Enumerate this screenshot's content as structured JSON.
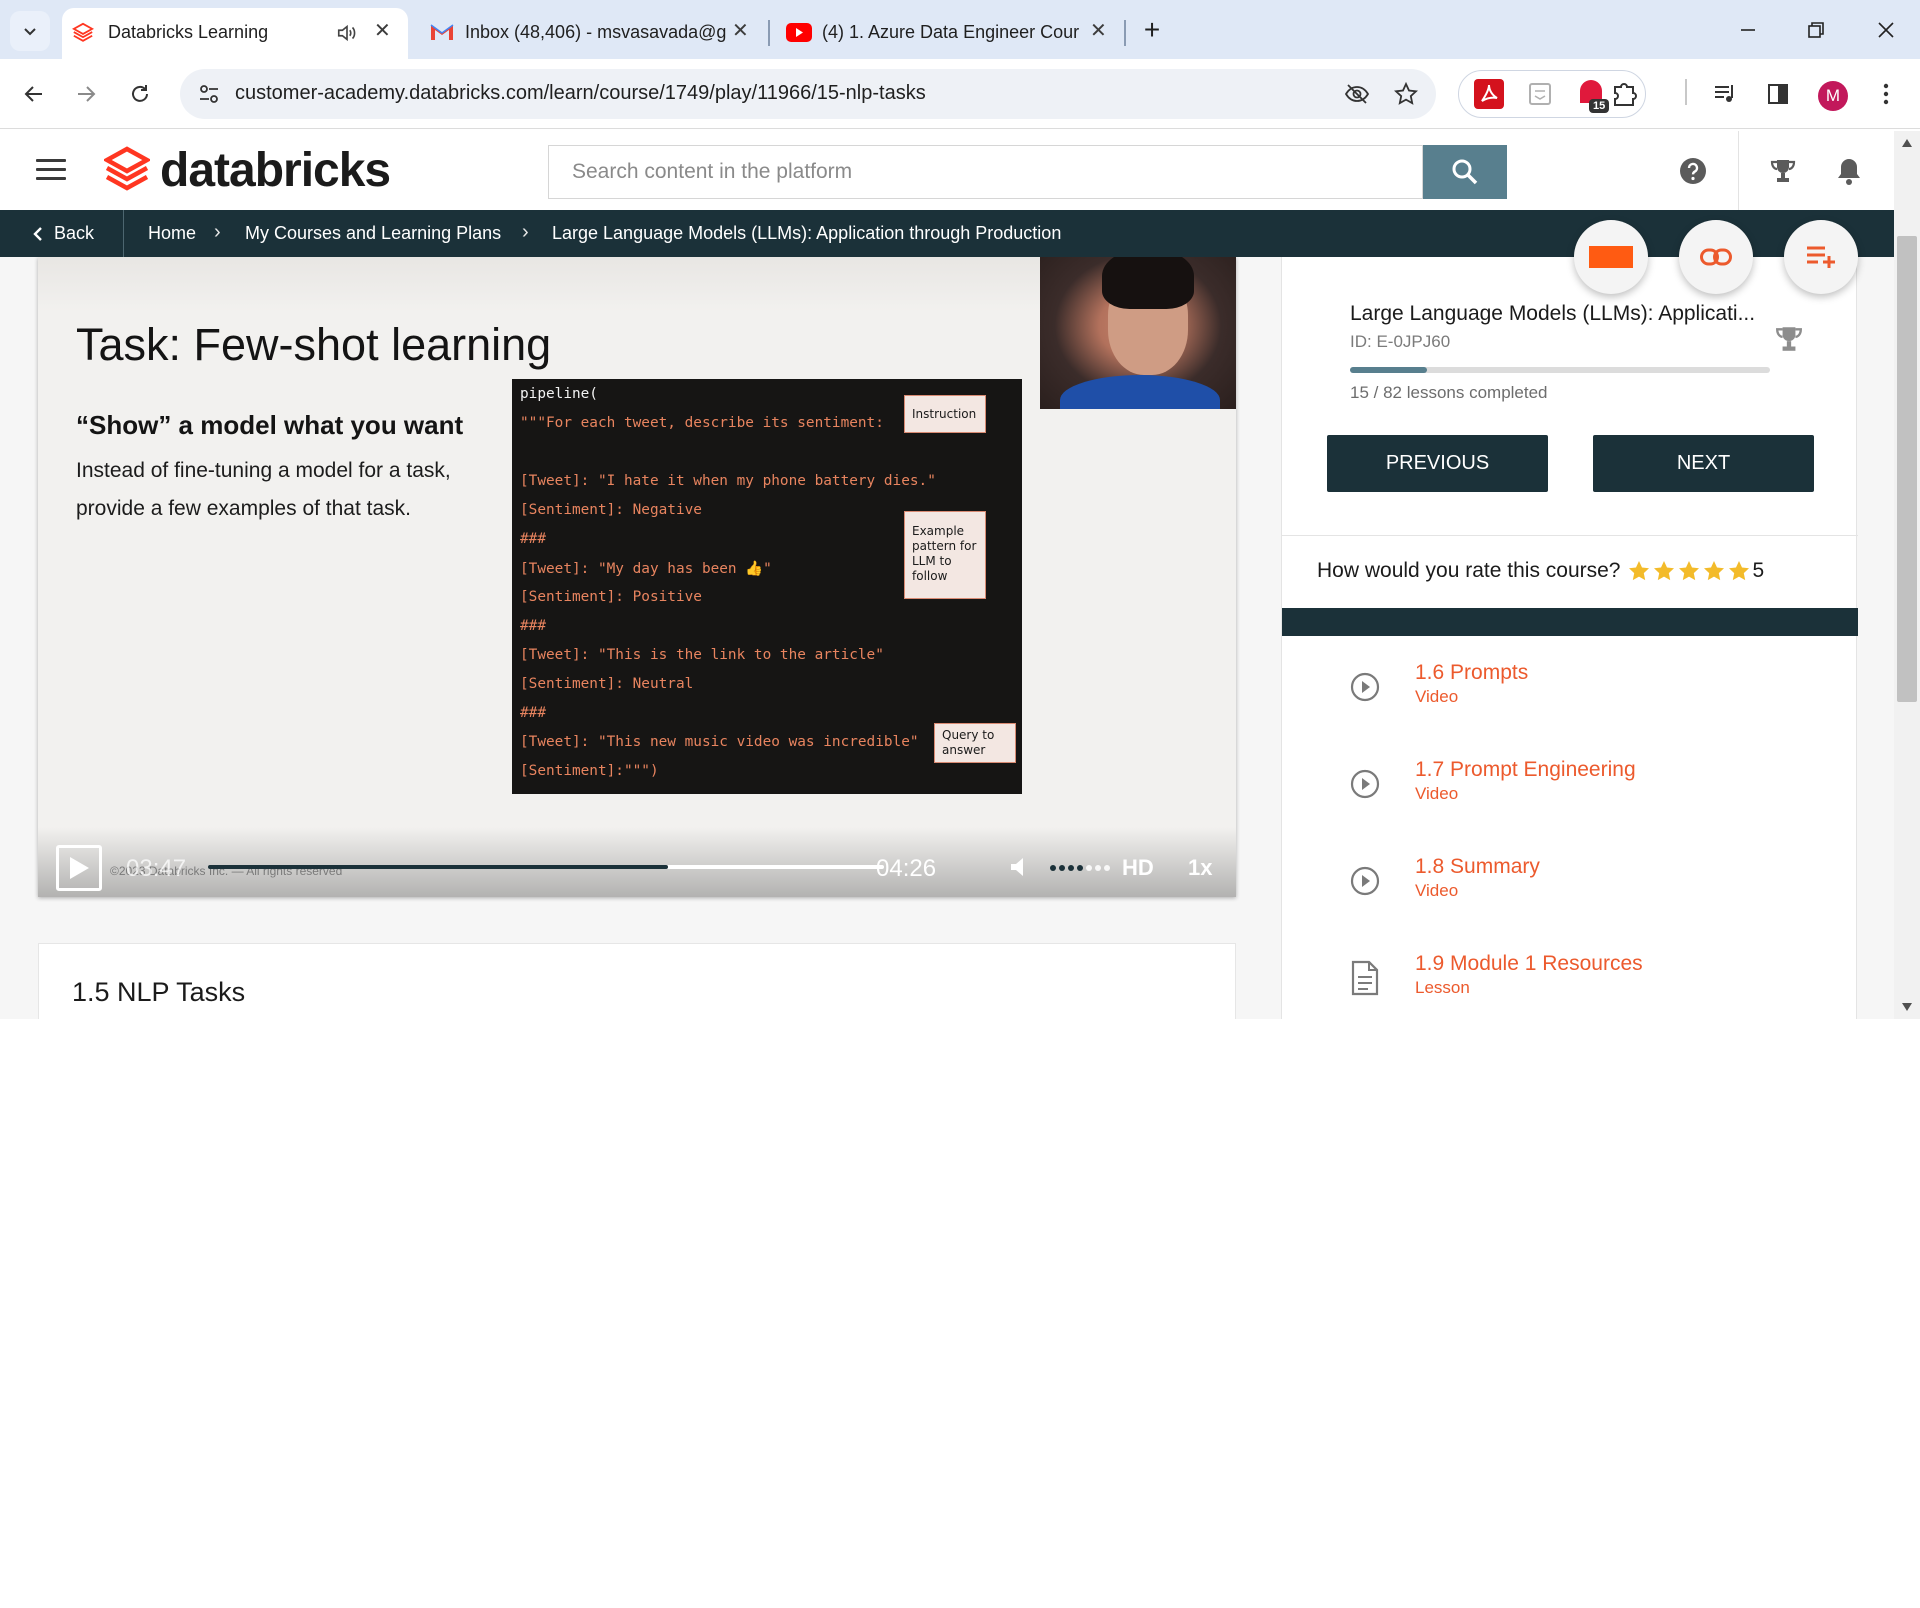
{
  "browser": {
    "tabs": [
      {
        "title": "Databricks Learning",
        "active": true
      },
      {
        "title": "Inbox (48,406) - msvasavada@g",
        "active": false
      },
      {
        "title": "(4) 1. Azure Data Engineer Cour",
        "active": false
      }
    ],
    "url": "customer-academy.databricks.com/learn/course/1749/play/11966/15-nlp-tasks",
    "extension_badge": "15",
    "profile_initial": "M"
  },
  "site": {
    "brand": "databricks",
    "search_placeholder": "Search content in the platform",
    "brand_color": "#ff3621",
    "accent_color": "#1b3139"
  },
  "breadcrumb": {
    "back": "Back",
    "items": [
      "Home",
      "My Courses and Learning Plans",
      "Large Language Models (LLMs): Application through Production"
    ]
  },
  "slide": {
    "title": "Task: Few-shot learning",
    "subtitle": "“Show” a model what you want",
    "body": "Instead of fine-tuning a model for a task, provide a few examples of that task.",
    "code_lines": [
      "pipeline(",
      "\"\"\"For each tweet, describe its sentiment:",
      "",
      "[Tweet]: \"I hate it when my phone battery dies.\"",
      "[Sentiment]: Negative",
      "###",
      "[Tweet]: \"My day has been 👍\"",
      "[Sentiment]: Positive",
      "###",
      "[Tweet]: \"This is the link to the article\"",
      "[Sentiment]: Neutral",
      "###",
      "[Tweet]: \"This new music video was incredible\"",
      "[Sentiment]:\"\"\")"
    ],
    "notes": {
      "instruction": "Instruction",
      "example": "Example pattern for LLM to follow",
      "query": "Query to answer"
    },
    "copyright": "©2023 Databricks Inc. — All rights reserved"
  },
  "player": {
    "current_time": "03:47",
    "duration": "04:26",
    "progress": 0.68,
    "volume_level": 0.57,
    "quality": "HD",
    "speed": "1x"
  },
  "lesson": {
    "title": "1.5 NLP Tasks"
  },
  "course": {
    "name": "Large Language Models (LLMs): Applicati...",
    "id": "ID: E-0JPJ60",
    "completed_fraction": 0.183,
    "progress_text": "15 / 82 lessons completed",
    "previous": "PREVIOUS",
    "next": "NEXT",
    "rating_prompt": "How would you rate this course?",
    "rating": "5"
  },
  "lessons": [
    {
      "title": "1.6 Prompts",
      "type": "Video",
      "icon": "play-circle-icon"
    },
    {
      "title": "1.7 Prompt Engineering",
      "type": "Video",
      "icon": "play-circle-icon"
    },
    {
      "title": "1.8 Summary",
      "type": "Video",
      "icon": "play-circle-icon"
    },
    {
      "title": "1.9 Module 1 Resources",
      "type": "Lesson",
      "icon": "document-icon"
    }
  ]
}
